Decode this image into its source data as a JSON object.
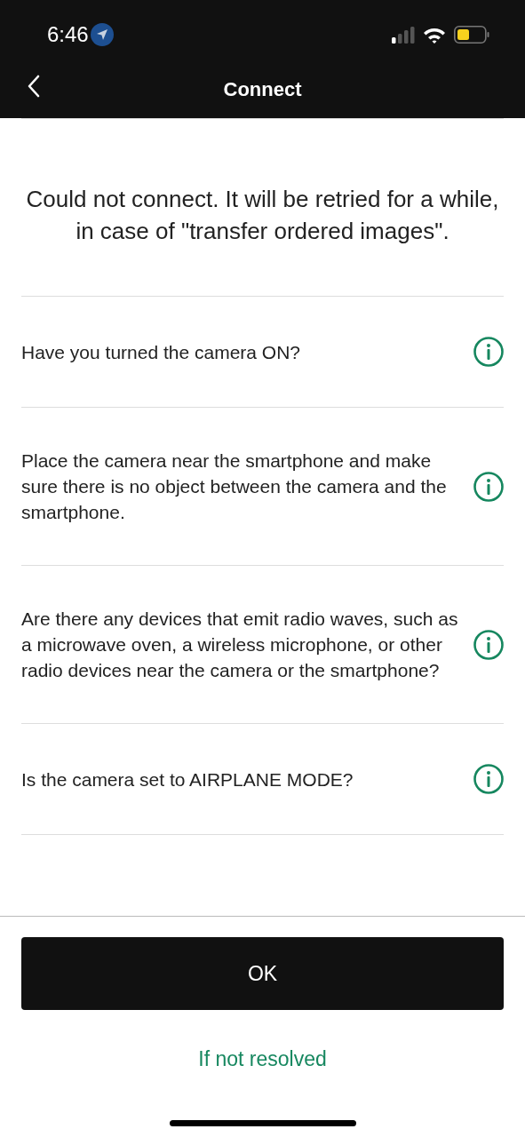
{
  "status_bar": {
    "time": "6:46"
  },
  "nav": {
    "title": "Connect"
  },
  "message": "Could not connect. It will be retried for a while,  in case of \"transfer ordered images\".",
  "checks": [
    {
      "text": "Have you turned the camera ON?"
    },
    {
      "text": "Place the camera near the smartphone and make sure there is no object between the camera and the smartphone."
    },
    {
      "text": "Are there any devices that emit radio waves, such as a microwave oven, a wireless microphone, or other radio devices near the camera or the smartphone?"
    },
    {
      "text": "Is the camera set to AIRPLANE MODE?"
    }
  ],
  "ok_button": "OK",
  "link": "If not resolved"
}
